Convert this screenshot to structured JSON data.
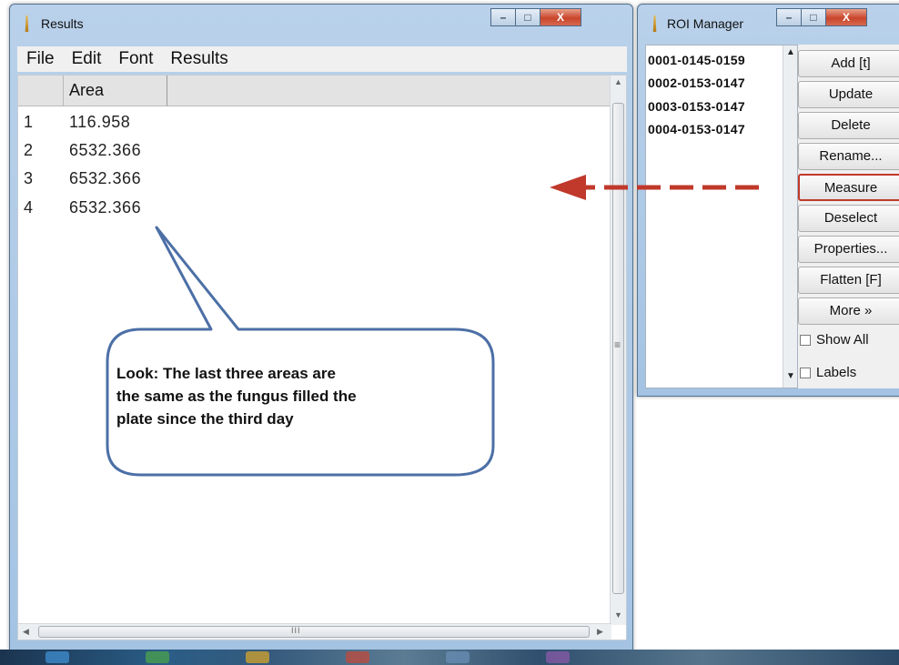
{
  "results_window": {
    "title": "Results",
    "menu": [
      "File",
      "Edit",
      "Font",
      "Results"
    ],
    "table": {
      "column_header": "Area",
      "rows": [
        {
          "index": "1",
          "area": "116.958"
        },
        {
          "index": "2",
          "area": "6532.366"
        },
        {
          "index": "3",
          "area": "6532.366"
        },
        {
          "index": "4",
          "area": "6532.366"
        }
      ]
    },
    "hscroll_grip": "III",
    "vscroll_grip": "≡"
  },
  "callout": {
    "text_line1": "Look: The last three areas are",
    "text_line2": "the same as the fungus filled the",
    "text_line3": "plate since the third day"
  },
  "roi_manager": {
    "title": "ROI Manager",
    "items": [
      "0001-0145-0159",
      "0002-0153-0147",
      "0003-0153-0147",
      "0004-0153-0147"
    ],
    "buttons": [
      "Add [t]",
      "Update",
      "Delete",
      "Rename...",
      "Measure",
      "Deselect",
      "Properties...",
      "Flatten [F]",
      "More »"
    ],
    "highlighted_button": "Measure",
    "checkboxes": [
      {
        "label": "Show All",
        "checked": false
      },
      {
        "label": "Labels",
        "checked": false
      }
    ]
  },
  "colors": {
    "arrow": "#c0392b",
    "highlight_border": "#c0392b",
    "title_gradient_top": "#b9d1ea"
  },
  "window_controls": {
    "minimize": "–",
    "maximize": "□",
    "close": "X"
  }
}
